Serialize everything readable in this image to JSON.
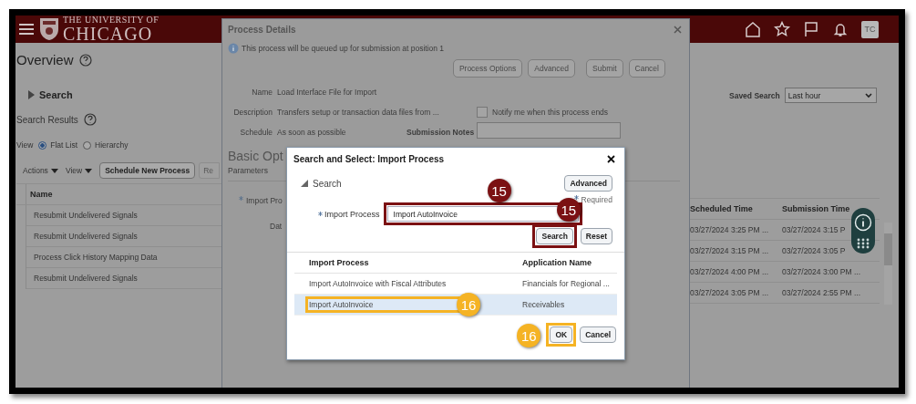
{
  "header": {
    "logo_top": "THE UNIVERSITY OF",
    "logo_bottom": "CHICAGO",
    "avatar": "TC"
  },
  "page": {
    "title": "Overview",
    "search_heading": "Search",
    "results_heading": "Search Results",
    "view_label": "View",
    "view_options": [
      {
        "label": "Flat List",
        "selected": true
      },
      {
        "label": "Hierarchy",
        "selected": false
      }
    ],
    "menus": [
      "Actions",
      "View"
    ],
    "schedule_button": "Schedule New Process",
    "cut_button": "Re",
    "saved_search_label": "Saved Search",
    "saved_search_value": "Last hour",
    "table": {
      "columns": [
        "Name",
        "Scheduled Time",
        "Submission Time"
      ],
      "rows": [
        {
          "name": "Resubmit Undelivered Signals",
          "scheduled": "03/27/2024 3:25 PM ...",
          "submitted": "03/27/2024 3:15 P"
        },
        {
          "name": "Resubmit Undelivered Signals",
          "scheduled": "03/27/2024 3:15 PM ...",
          "submitted": "03/27/2024 3:05 P"
        },
        {
          "name": "Process Click History Mapping Data",
          "scheduled": "03/27/2024 4:00 PM ...",
          "submitted": "03/27/2024 3:00 PM ..."
        },
        {
          "name": "Resubmit Undelivered Signals",
          "scheduled": "03/27/2024 3:05 PM ...",
          "submitted": "03/27/2024 2:55 PM ..."
        }
      ]
    }
  },
  "process_dialog": {
    "title": "Process Details",
    "info": "This process will be queued up for submission at position 1",
    "buttons": [
      "Process Options",
      "Advanced",
      "Submit",
      "Cancel"
    ],
    "fields": [
      {
        "label": "Name",
        "value": "Load Interface File for Import"
      },
      {
        "label": "Description",
        "value": "Transfers setup or transaction data files from ..."
      },
      {
        "label": "Schedule",
        "value": "As soon as possible"
      }
    ],
    "notify": {
      "label": "Notify me when this process ends",
      "checked": false
    },
    "notes_label": "Submission Notes",
    "section": "Basic Opt",
    "parameters": "Parameters",
    "params": [
      {
        "label": "Import Pro",
        "required": true
      },
      {
        "label": "Dat",
        "required": false
      }
    ]
  },
  "search_dialog": {
    "title": "Search and Select: Import Process",
    "toggle": "Search",
    "advanced": "Advanced",
    "required_note": "Required",
    "field": {
      "label": "Import Process",
      "value": "Import AutoInvoice",
      "required": true
    },
    "buttons": [
      "Search",
      "Reset"
    ],
    "table": {
      "columns": [
        "Import Process",
        "Application Name"
      ],
      "rows": [
        {
          "cells": [
            "Import AutoInvoice with Fiscal Attributes",
            "Financials for Regional ..."
          ],
          "selected": false
        },
        {
          "cells": [
            "Import AutoInvoice",
            "Receivables"
          ],
          "selected": true
        }
      ]
    },
    "footer_buttons": [
      "OK",
      "Cancel"
    ]
  },
  "annotations": [
    {
      "number": "15",
      "color": "#7b1113"
    },
    {
      "number": "15",
      "color": "#7b1113"
    },
    {
      "number": "16",
      "color": "#f5b324"
    },
    {
      "number": "16",
      "color": "#f5b324"
    }
  ]
}
